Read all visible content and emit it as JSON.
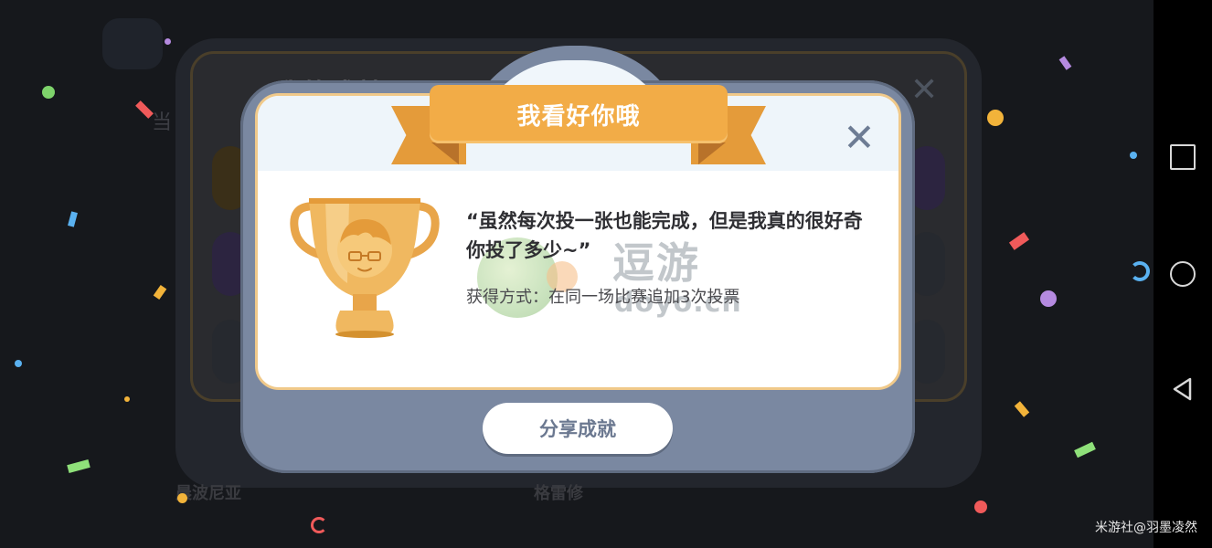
{
  "background": {
    "title": "我的成就",
    "label_left": "当",
    "bottom_texts": [
      "晨波尼亚",
      "格雷修"
    ]
  },
  "modal": {
    "title": "我看好你哦",
    "quote": "“虽然每次投一张也能完成，但是我真的很好奇你投了多少~”",
    "method": "获得方式：在同一场比赛追加3次投票",
    "close_icon": "close-icon",
    "share_label": "分享成就"
  },
  "watermark": {
    "big": "逗游",
    "small": "doyo.cn"
  },
  "credit": "米游社@羽墨凌然",
  "icons": {
    "trophy": "trophy-icon",
    "nav_recent": "square-icon",
    "nav_home": "circle-icon",
    "nav_back": "triangle-back-icon"
  },
  "colors": {
    "ribbon": "#f2ac47",
    "modal_frame": "#7a88a1",
    "card_border": "#f0c98a",
    "close": "#6d7c94",
    "share_text": "#6b7890"
  }
}
